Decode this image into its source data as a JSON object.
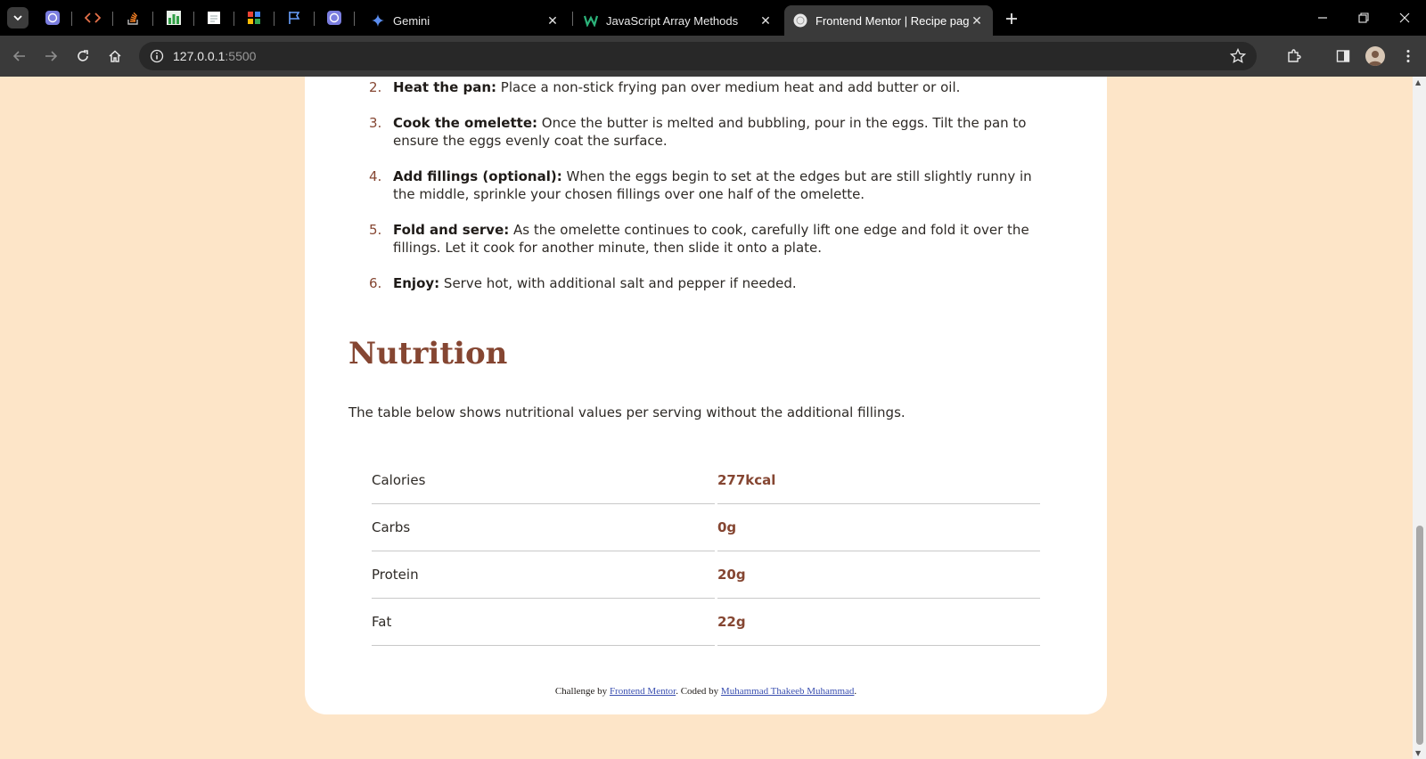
{
  "browser": {
    "tabs": [
      {
        "title": "Gemini",
        "favicon": "gemini-icon"
      },
      {
        "title": "JavaScript Array Methods",
        "favicon": "w-logo-icon"
      },
      {
        "title": "Frontend Mentor | Recipe page",
        "favicon": "globe-icon",
        "active": true
      }
    ],
    "address": {
      "host": "127.0.0.1",
      "port": ":5500"
    }
  },
  "recipe": {
    "steps": [
      {
        "number": "2.",
        "title": "Heat the pan:",
        "text": " Place a non-stick frying pan over medium heat and add butter or oil."
      },
      {
        "number": "3.",
        "title": "Cook the omelette:",
        "text": " Once the butter is melted and bubbling, pour in the eggs. Tilt the pan to ensure the eggs evenly coat the surface."
      },
      {
        "number": "4.",
        "title": "Add fillings (optional):",
        "text": " When the eggs begin to set at the edges but are still slightly runny in the middle, sprinkle your chosen fillings over one half of the omelette."
      },
      {
        "number": "5.",
        "title": "Fold and serve:",
        "text": " As the omelette continues to cook, carefully lift one edge and fold it over the fillings. Let it cook for another minute, then slide it onto a plate."
      },
      {
        "number": "6.",
        "title": "Enjoy:",
        "text": " Serve hot, with additional salt and pepper if needed."
      }
    ],
    "nutrition": {
      "heading": "Nutrition",
      "description": "The table below shows nutritional values per serving without the additional fillings.",
      "rows": [
        {
          "label": "Calories",
          "value": "277kcal"
        },
        {
          "label": "Carbs",
          "value": "0g"
        },
        {
          "label": "Protein",
          "value": "20g"
        },
        {
          "label": "Fat",
          "value": "22g"
        }
      ]
    },
    "footer": {
      "prefix": "Challenge by ",
      "link1": "Frontend Mentor",
      "middle": ". Coded by ",
      "link2": "Muhammad Thakeeb Muhammad",
      "suffix": "."
    }
  },
  "colors": {
    "page_bg": "#fde5c8",
    "accent": "#854632"
  }
}
